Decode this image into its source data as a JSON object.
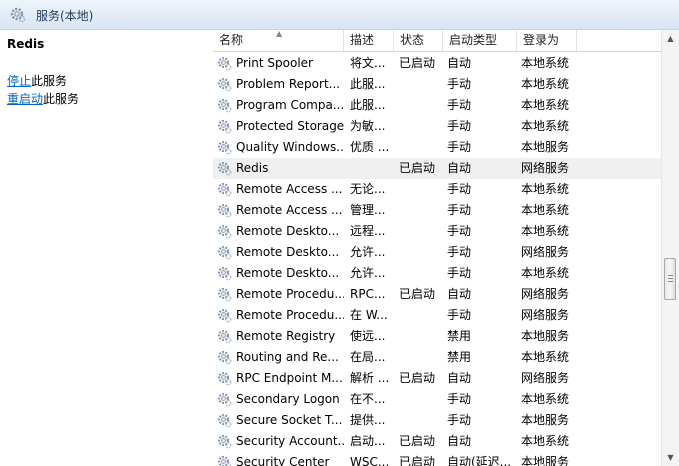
{
  "window": {
    "title": "服务(本地)"
  },
  "left_panel": {
    "service_name": "Redis",
    "actions": [
      {
        "link": "停止",
        "text": "此服务"
      },
      {
        "link": "重启动",
        "text": "此服务"
      }
    ]
  },
  "table": {
    "columns": [
      "名称",
      "描述",
      "状态",
      "启动类型",
      "登录为"
    ],
    "sorted_column": "名称",
    "selected_row": "Redis",
    "rows": [
      {
        "name": "Print Spooler",
        "desc": "将文...",
        "status": "已启动",
        "startup": "自动",
        "logon": "本地系统"
      },
      {
        "name": "Problem Report...",
        "desc": "此服...",
        "status": "",
        "startup": "手动",
        "logon": "本地系统"
      },
      {
        "name": "Program Compa...",
        "desc": "此服...",
        "status": "",
        "startup": "手动",
        "logon": "本地系统"
      },
      {
        "name": "Protected Storage",
        "desc": "为敏...",
        "status": "",
        "startup": "手动",
        "logon": "本地系统"
      },
      {
        "name": "Quality Windows...",
        "desc": "优质 ...",
        "status": "",
        "startup": "手动",
        "logon": "本地服务"
      },
      {
        "name": "Redis",
        "desc": "",
        "status": "已启动",
        "startup": "自动",
        "logon": "网络服务"
      },
      {
        "name": "Remote Access ...",
        "desc": "无论...",
        "status": "",
        "startup": "手动",
        "logon": "本地系统"
      },
      {
        "name": "Remote Access ...",
        "desc": "管理...",
        "status": "",
        "startup": "手动",
        "logon": "本地系统"
      },
      {
        "name": "Remote Deskto...",
        "desc": "远程...",
        "status": "",
        "startup": "手动",
        "logon": "本地系统"
      },
      {
        "name": "Remote Deskto...",
        "desc": "允许...",
        "status": "",
        "startup": "手动",
        "logon": "网络服务"
      },
      {
        "name": "Remote Deskto...",
        "desc": "允许...",
        "status": "",
        "startup": "手动",
        "logon": "本地系统"
      },
      {
        "name": "Remote Procedu...",
        "desc": "RPC...",
        "status": "已启动",
        "startup": "自动",
        "logon": "网络服务"
      },
      {
        "name": "Remote Procedu...",
        "desc": "在 W...",
        "status": "",
        "startup": "手动",
        "logon": "网络服务"
      },
      {
        "name": "Remote Registry",
        "desc": "使远...",
        "status": "",
        "startup": "禁用",
        "logon": "本地服务"
      },
      {
        "name": "Routing and Re...",
        "desc": "在局...",
        "status": "",
        "startup": "禁用",
        "logon": "本地系统"
      },
      {
        "name": "RPC Endpoint M...",
        "desc": "解析 ...",
        "status": "已启动",
        "startup": "自动",
        "logon": "网络服务"
      },
      {
        "name": "Secondary Logon",
        "desc": "在不...",
        "status": "",
        "startup": "手动",
        "logon": "本地系统"
      },
      {
        "name": "Secure Socket T...",
        "desc": "提供...",
        "status": "",
        "startup": "手动",
        "logon": "本地服务"
      },
      {
        "name": "Security Account...",
        "desc": "启动...",
        "status": "已启动",
        "startup": "自动",
        "logon": "本地系统"
      },
      {
        "name": "Security Center",
        "desc": "WSC...",
        "status": "已启动",
        "startup": "自动(延迟...",
        "logon": "本地服务"
      }
    ]
  }
}
